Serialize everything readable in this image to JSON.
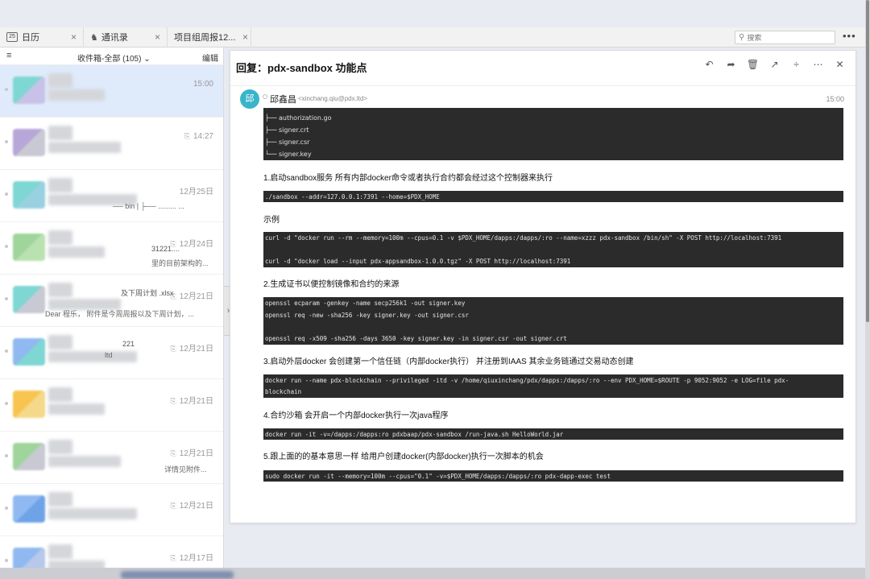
{
  "tabs": [
    {
      "label": "日历",
      "icon": "calendar-icon",
      "icon_text": "25"
    },
    {
      "label": "通讯录",
      "icon": "contacts-icon"
    },
    {
      "label": "项目组周报12...",
      "icon": ""
    }
  ],
  "search": {
    "placeholder": "搜索"
  },
  "sidebar": {
    "folder_label": "收件箱-全部 (105)",
    "edit_label": "编辑",
    "mails": [
      {
        "time": "15:00",
        "attachment": false,
        "extra": "",
        "preview": "",
        "colors": [
          "#7fd7d3",
          "#c9c2e8"
        ]
      },
      {
        "time": "14:27",
        "attachment": true,
        "extra": "",
        "preview": "",
        "colors": [
          "#b7a7d8",
          "#c9c9d4"
        ]
      },
      {
        "time": "12月25日",
        "attachment": false,
        "extra": "",
        "preview": "── bin  |    ├──  ......... ...",
        "colors": [
          "#7fd7d3",
          "#9ad1e0"
        ]
      },
      {
        "time": "12月24日",
        "attachment": true,
        "extra": "31221....",
        "preview": "里的目前架构的...",
        "colors": [
          "#9fd59a",
          "#b9e2b0"
        ]
      },
      {
        "time": "12月21日",
        "attachment": true,
        "extra": "及下周计划 .xlsx",
        "preview": "Dear 程乐，  附件是今周周报以及下周计划，...",
        "colors": [
          "#7fd7d3",
          "#c9c9d4"
        ]
      },
      {
        "time": "12月21日",
        "attachment": true,
        "extra": "221",
        "preview": "ltd",
        "colors": [
          "#8fb9f0",
          "#7fd7d3"
        ]
      },
      {
        "time": "12月21日",
        "attachment": true,
        "extra": "",
        "preview": "",
        "colors": [
          "#f7c54f",
          "#f5d98a"
        ]
      },
      {
        "time": "12月21日",
        "attachment": true,
        "extra": "",
        "preview": "详情见附件...",
        "colors": [
          "#9fd59a",
          "#c9c9d4"
        ]
      },
      {
        "time": "12月21日",
        "attachment": true,
        "extra": "",
        "preview": "",
        "colors": [
          "#8fb9f0",
          "#6fa3e8"
        ]
      },
      {
        "time": "12月17日",
        "attachment": true,
        "extra": "",
        "preview": "",
        "colors": [
          "#8fb9f0",
          "#b7c8ea"
        ]
      }
    ]
  },
  "message": {
    "subject": "回复：pdx-sandbox 功能点",
    "sender_initial": "邱",
    "sender_name": "邱鑫昌",
    "sender_email": "<xinchang.qiu@pdx.ltd>",
    "time": "15:00",
    "tree_lines": [
      "├── authorization.go",
      "├── signer.crt",
      "├── signer.csr",
      "└── signer.key"
    ],
    "p1": "1.启动sandbox服务  所有内部docker命令或者执行合约都会经过这个控制器来执行",
    "c1": "./sandbox --addr=127.0.0.1:7391 --home=$PDX_HOME",
    "p_example": "示例",
    "c2a": "curl -d \"docker run --rm --memory=100m --cpus=0.1 -v $PDX_HOME/dapps:/dapps/:ro --name=xzzz pdx-sandbox /bin/sh\" -X POST http://localhost:7391",
    "c2b": "curl -d \"docker load --input pdx-appsandbox-1.0.0.tgz\" -X POST http://localhost:7391",
    "p2": "2.生成证书以便控制镜像和合约的来源",
    "c3a": "openssl ecparam -genkey -name secp256k1 -out signer.key",
    "c3b": "openssl req -new -sha256 -key signer.key -out signer.csr",
    "c3c": "openssl req -x509 -sha256 -days 3650 -key signer.key -in signer.csr -out signer.crt",
    "p3": "3.启动外层docker 会创建第一个信任链（内部docker执行） 并注册到IAAS   其余业务链通过交易动态创建",
    "c4a": "docker run   --name pdx-blockchain --privileged -itd -v /home/qiuxinchang/pdx/dapps:/dapps/:ro   --env PDX_HOME=$ROUTE  -p 9052:9052 -e LOG=file pdx-",
    "c4b": "blockchain",
    "p4": "4.合约沙箱 会开启一个内部docker执行一次java程序",
    "c5": "docker run -it -v=/dapps:/dapps:ro pdxbaap/pdx-sandbox /run-java.sh HelloWorld.jar",
    "p5": "5.跟上面的的基本意思一样 给用户创建docker(内部docker)执行一次脚本的机会",
    "c6": "sudo docker run -it --memory=100m --cpus=\"0.1\" -v=$PDX_HOME/dapps:/dapps/:ro pdx-dapp-exec test"
  }
}
